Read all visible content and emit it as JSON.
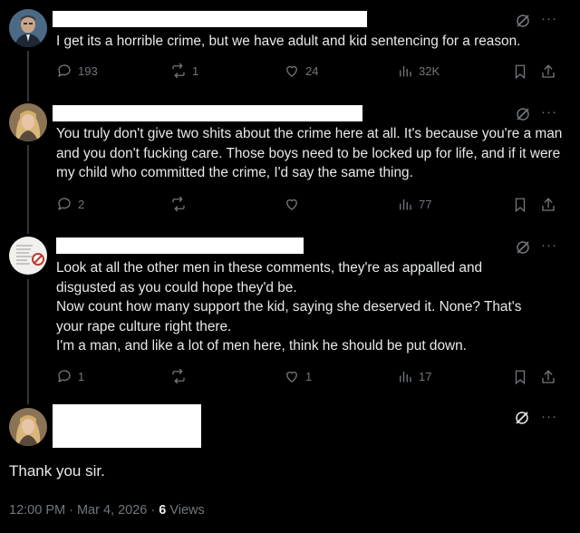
{
  "replies": [
    {
      "text": "I get its a horrible crime, but we have adult and kid sentencing for a reason.",
      "replies_count": "193",
      "reposts_count": "1",
      "likes_count": "24",
      "views_count": "32K"
    },
    {
      "text": "You truly don't give two shits about the crime here at all. It's because you're a man and you don't fucking care. Those boys need to be locked up for life, and if it were my child who committed the crime, I'd say the same thing.",
      "replies_count": "2",
      "reposts_count": "",
      "likes_count": "",
      "views_count": "77"
    },
    {
      "text_lines": [
        "Look at all the other men in these comments, they're as appalled and",
        "disgusted as you could hope they'd be.",
        "Now count how many support the kid, saying she deserved it. None? That's",
        "your rape culture right there.",
        "I'm a man, and like a lot of men here, think he should be put down."
      ],
      "replies_count": "1",
      "reposts_count": "",
      "likes_count": "1",
      "views_count": "17"
    }
  ],
  "main_post": {
    "text": "Thank you sir.",
    "time": "12:00 PM",
    "date": "Mar 4, 2026",
    "views_count": "6",
    "views_label": "Views"
  },
  "icons": [
    "reply-icon",
    "repost-icon",
    "like-icon",
    "views-icon",
    "bookmark-icon",
    "share-icon",
    "grok-icon",
    "more-icon"
  ]
}
